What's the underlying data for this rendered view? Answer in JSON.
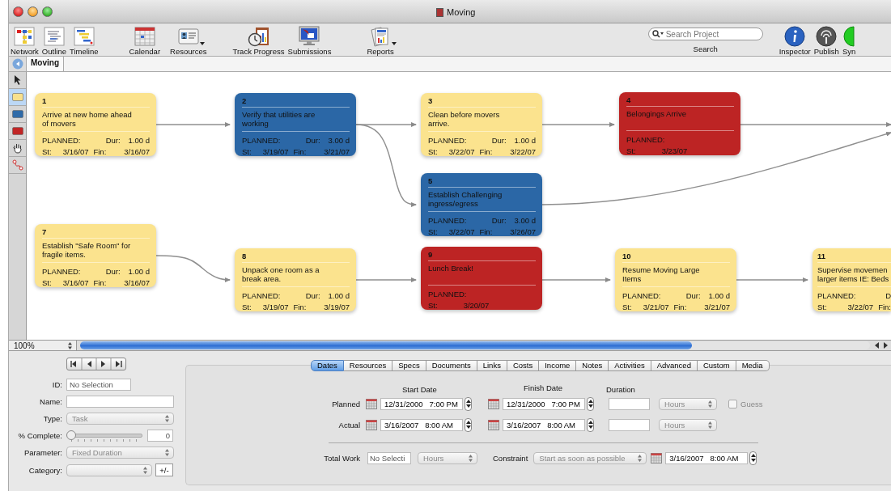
{
  "window": {
    "title": "Moving"
  },
  "toolbar": {
    "items": [
      {
        "label": "Network",
        "kind": "network",
        "menu": false
      },
      {
        "label": "Outline",
        "kind": "outline",
        "menu": false
      },
      {
        "label": "Timeline",
        "kind": "timeline",
        "menu": false
      },
      {
        "label": "Calendar",
        "kind": "calendar",
        "menu": false
      },
      {
        "label": "Resources",
        "kind": "resources",
        "menu": true
      },
      {
        "label": "Track Progress",
        "kind": "track",
        "menu": false
      },
      {
        "label": "Submissions",
        "kind": "submissions",
        "menu": false
      },
      {
        "label": "Reports",
        "kind": "reports",
        "menu": true
      }
    ],
    "search": {
      "placeholder": "Search Project",
      "label": "Search"
    },
    "right_items": [
      {
        "label": "Inspector",
        "kind": "inspector"
      },
      {
        "label": "Publish",
        "kind": "publish"
      },
      {
        "label": "Syn",
        "kind": "sync"
      }
    ]
  },
  "document_tabs": [
    {
      "label": "Moving",
      "selected": true
    }
  ],
  "tools": [
    {
      "kind": "pointer",
      "selected": false
    },
    {
      "kind": "node",
      "color": "#f8e08c",
      "selected": true
    },
    {
      "kind": "node",
      "color": "#2e6aa8",
      "selected": false
    },
    {
      "kind": "node",
      "color": "#c12626",
      "selected": false
    },
    {
      "kind": "hand",
      "selected": false
    },
    {
      "kind": "connector",
      "selected": false
    }
  ],
  "network": {
    "nodes": [
      {
        "id": "1",
        "color": "#fbe38e",
        "title": "Arrive at new home ahead\nof movers",
        "planned": "PLANNED:",
        "dur_label": "Dur:",
        "dur": "1.00 d",
        "st_label": "St:",
        "st": "3/16/07",
        "fin_label": "Fin:",
        "fin": "3/16/07"
      },
      {
        "id": "2",
        "color": "#2b67a6",
        "title": "Verify that utilities are\nworking",
        "planned": "PLANNED:",
        "dur_label": "Dur:",
        "dur": "3.00 d",
        "st_label": "St:",
        "st": "3/19/07",
        "fin_label": "Fin:",
        "fin": "3/21/07"
      },
      {
        "id": "3",
        "color": "#fbe38e",
        "title": "Clean before movers\narrive.",
        "planned": "PLANNED:",
        "dur_label": "Dur:",
        "dur": "1.00 d",
        "st_label": "St:",
        "st": "3/22/07",
        "fin_label": "Fin:",
        "fin": "3/22/07"
      },
      {
        "id": "4",
        "color": "#bd2424",
        "title": "Belongings Arrive",
        "planned": "PLANNED:",
        "st_label": "St:",
        "st": "3/23/07"
      },
      {
        "id": "5",
        "color": "#2b67a6",
        "title": "Establish Challenging\ningress/egress",
        "planned": "PLANNED:",
        "dur_label": "Dur:",
        "dur": "3.00 d",
        "st_label": "St:",
        "st": "3/22/07",
        "fin_label": "Fin:",
        "fin": "3/26/07"
      },
      {
        "id": "7",
        "color": "#fbe38e",
        "title": "Establish \"Safe Room\" for\nfragile items.",
        "planned": "PLANNED:",
        "dur_label": "Dur:",
        "dur": "1.00 d",
        "st_label": "St:",
        "st": "3/16/07",
        "fin_label": "Fin:",
        "fin": "3/16/07"
      },
      {
        "id": "8",
        "color": "#fbe38e",
        "title": "Unpack one room as a\nbreak area.",
        "planned": "PLANNED:",
        "dur_label": "Dur:",
        "dur": "1.00 d",
        "st_label": "St:",
        "st": "3/19/07",
        "fin_label": "Fin:",
        "fin": "3/19/07"
      },
      {
        "id": "9",
        "color": "#bd2424",
        "title": "Lunch Break!",
        "planned": "PLANNED:",
        "st_label": "St:",
        "st": "3/20/07"
      },
      {
        "id": "10",
        "color": "#fbe38e",
        "title": "Resume Moving Large\nItems",
        "planned": "PLANNED:",
        "dur_label": "Dur:",
        "dur": "1.00 d",
        "st_label": "St:",
        "st": "3/21/07",
        "fin_label": "Fin:",
        "fin": "3/21/07"
      },
      {
        "id": "11",
        "color": "#fbe38e",
        "title": "Supervise movemen\nlarger items IE: Beds",
        "planned": "PLANNED:",
        "dur_label": "D",
        "st_label": "St:",
        "st": "3/22/07",
        "fin_label": "Fin:"
      }
    ]
  },
  "zoom": "100%",
  "inspector": {
    "fields": [
      {
        "label": "ID:",
        "kind": "text",
        "value": "No Selection"
      },
      {
        "label": "Name:",
        "kind": "text"
      },
      {
        "label": "Type:",
        "kind": "select",
        "value": "Task"
      },
      {
        "label": "% Complete:",
        "kind": "slider",
        "level": 0,
        "value": "0"
      },
      {
        "label": "Parameter:",
        "kind": "select",
        "value": "Fixed Duration"
      },
      {
        "label": "Category:",
        "kind": "select-add",
        "button": "+/-"
      }
    ]
  },
  "tabs": [
    {
      "label": "Dates",
      "selected": true
    },
    {
      "label": "Resources",
      "selected": false
    },
    {
      "label": "Specs",
      "selected": false
    },
    {
      "label": "Documents",
      "selected": false
    },
    {
      "label": "Links",
      "selected": false
    },
    {
      "label": "Costs",
      "selected": false
    },
    {
      "label": "Income",
      "selected": false
    },
    {
      "label": "Notes",
      "selected": false
    },
    {
      "label": "Activities",
      "selected": false
    },
    {
      "label": "Advanced",
      "selected": false
    },
    {
      "label": "Custom",
      "selected": false
    },
    {
      "label": "Media",
      "selected": false
    }
  ],
  "dates": {
    "headers": [
      "Start Date",
      "Finish Date",
      "Duration"
    ],
    "rows": [
      {
        "label": "Planned",
        "start": "12/31/2000   7:00 PM",
        "finish": "12/31/2000   7:00 PM",
        "unit": "Hours",
        "guess": {
          "label": "Guess",
          "checked": false
        }
      },
      {
        "label": "Actual",
        "start": "3/16/2007   8:00 AM",
        "finish": "3/16/2007   8:00 AM",
        "unit": "Hours"
      }
    ],
    "total_work": {
      "label": "Total Work",
      "value": "No Selecti",
      "unit": "Hours"
    },
    "constraint": {
      "label": "Constraint",
      "value": "Start as soon as possible",
      "date": "3/16/2007   8:00 AM"
    }
  }
}
